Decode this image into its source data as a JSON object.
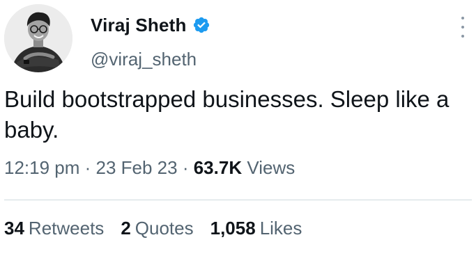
{
  "user": {
    "display_name": "Viraj Sheth",
    "handle": "@viraj_sheth",
    "verified_icon": "verified-badge-icon",
    "verified_color": "#1d9bf0"
  },
  "tweet": {
    "text": "Build bootstrapped businesses. Sleep like a baby.",
    "time": "12:19 pm",
    "sep1": " · ",
    "date": "23 Feb 23",
    "sep2": " · ",
    "views_count": "63.7K",
    "views_label": " Views"
  },
  "stats": {
    "retweets_count": "34",
    "retweets_label": "Retweets",
    "quotes_count": "2",
    "quotes_label": "Quotes",
    "likes_count": "1,058",
    "likes_label": "Likes"
  },
  "icons": {
    "more": "more-vertical-icon"
  }
}
